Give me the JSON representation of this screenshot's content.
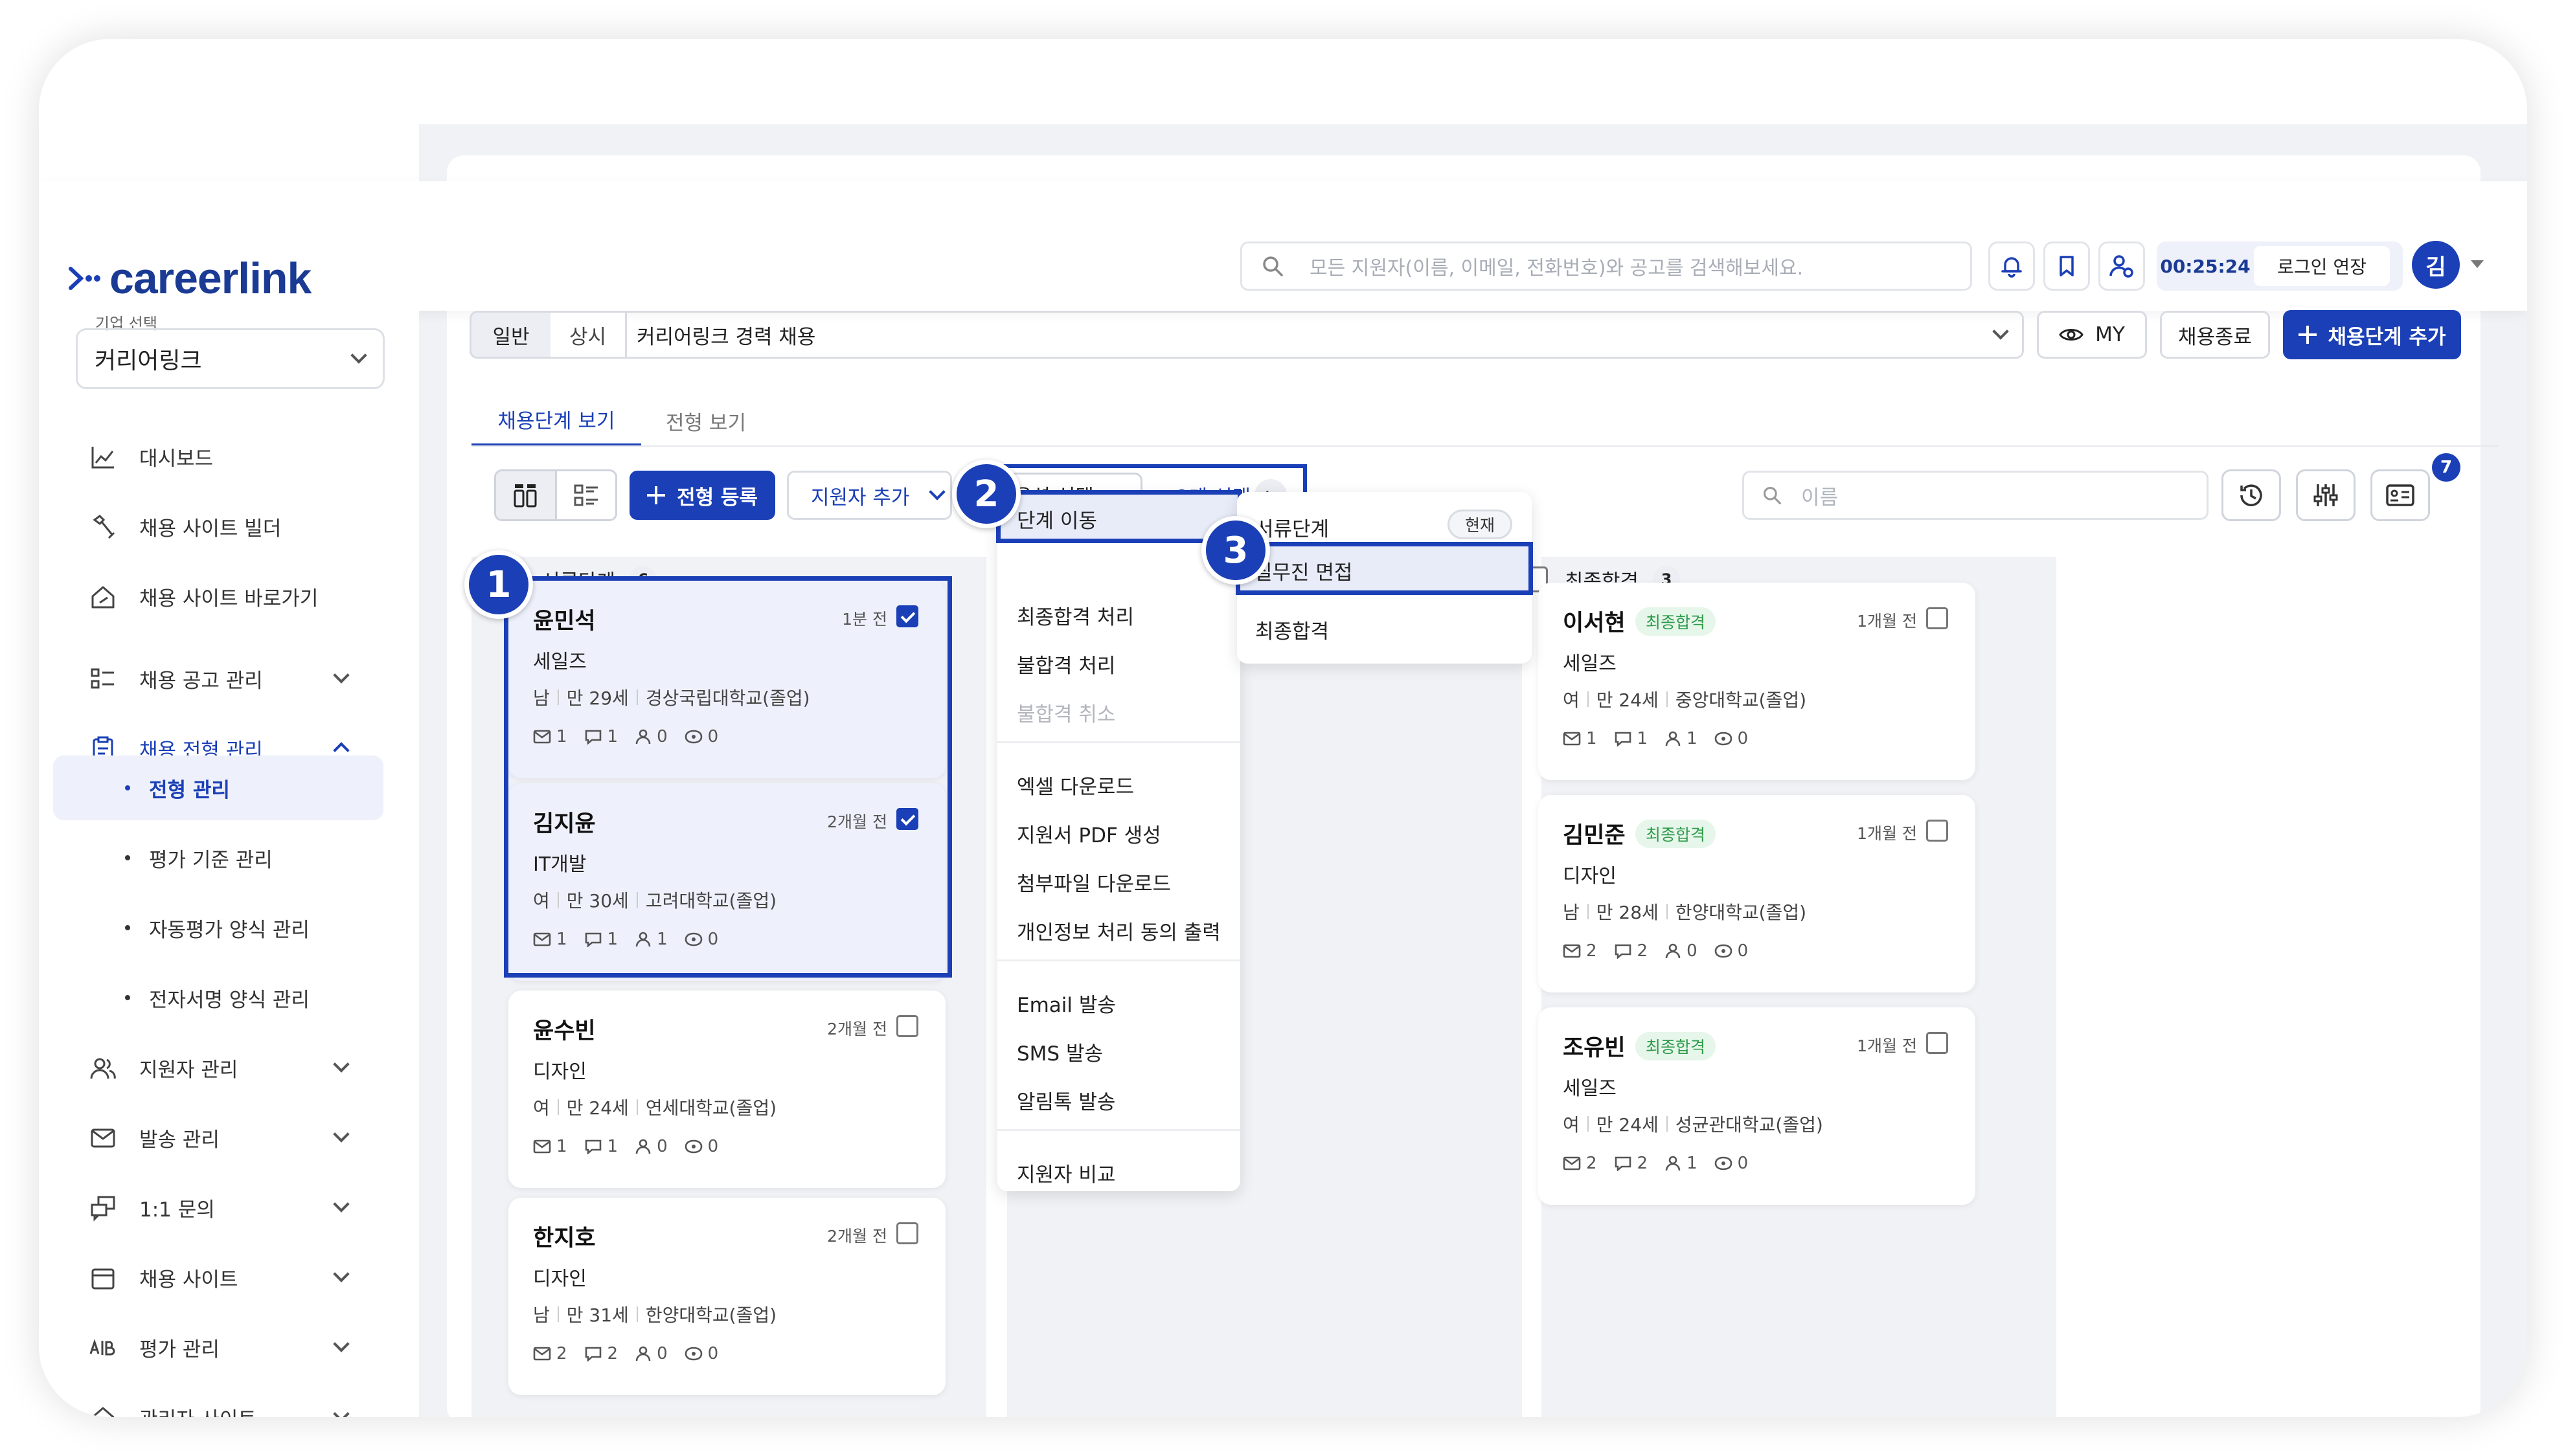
{
  "brand": {
    "logo_text": "careerlink",
    "accent": "#1a3fb6",
    "logo_color": "#1a3a94"
  },
  "header": {
    "search_placeholder": "모든 지원자(이름, 이메일, 전화번호)와 공고를 검색해보세요.",
    "icons": [
      "bell-icon",
      "bookmark-icon",
      "user-settings-icon"
    ],
    "timer": "00:25:24",
    "extend_login": "로그인 연장",
    "avatar_initial": "김"
  },
  "sidebar": {
    "company_label": "기업 선택",
    "company_value": "커리어링크",
    "items": [
      {
        "label": "대시보드",
        "icon": "chart-icon"
      },
      {
        "label": "채용 사이트 빌더",
        "icon": "tools-icon"
      },
      {
        "label": "채용 사이트 바로가기",
        "icon": "home-link-icon"
      },
      {
        "label": "채용 공고 관리",
        "icon": "list-icon"
      },
      {
        "label": "채용 전형 관리",
        "icon": "clipboard-icon"
      },
      {
        "label": "지원자 관리",
        "icon": "users-icon"
      },
      {
        "label": "발송 관리",
        "icon": "mail-icon"
      },
      {
        "label": "1:1 문의",
        "icon": "chat-icon"
      },
      {
        "label": "채용 사이트",
        "icon": "calendar-icon"
      },
      {
        "label": "평가 관리",
        "icon": "ab-icon"
      },
      {
        "label": "관리자 사이트",
        "icon": "admin-home-icon"
      }
    ],
    "sub_items": [
      "전형 관리",
      "평가 기준 관리",
      "자동평가 양식 관리",
      "전자서명 양식 관리"
    ]
  },
  "toolbar": {
    "type_tabs": [
      "일반",
      "상시"
    ],
    "job_title": "커리어링크 경력 채용",
    "my_label": "MY",
    "close_label": "채용종료",
    "add_stage_label": "채용단계 추가"
  },
  "tabs": [
    "채용단계 보기",
    "전형 보기"
  ],
  "actions": {
    "register_label": "전형 등록",
    "add_applicant_label": "지원자 추가",
    "option_select_label": "옵션 선택",
    "selected_count": "2개 선택",
    "name_search_placeholder": "이름",
    "notification_count": "7"
  },
  "columns": [
    {
      "title": "서류단계",
      "count": "6",
      "cards": [
        {
          "name": "윤민석",
          "time": "1분 전",
          "checked": true,
          "role": "세일즈",
          "gender": "남",
          "age": "만 29세",
          "school": "경상국립대학교(졸업)",
          "stats": [
            "1",
            "1",
            "0",
            "0"
          ]
        },
        {
          "name": "김지윤",
          "time": "2개월 전",
          "checked": true,
          "role": "IT개발",
          "gender": "여",
          "age": "만 30세",
          "school": "고려대학교(졸업)",
          "stats": [
            "1",
            "1",
            "1",
            "0"
          ]
        },
        {
          "name": "윤수빈",
          "time": "2개월 전",
          "checked": false,
          "role": "디자인",
          "gender": "여",
          "age": "만 24세",
          "school": "연세대학교(졸업)",
          "stats": [
            "1",
            "1",
            "0",
            "0"
          ]
        },
        {
          "name": "한지호",
          "time": "2개월 전",
          "checked": false,
          "role": "디자인",
          "gender": "남",
          "age": "만 31세",
          "school": "한양대학교(졸업)",
          "stats": [
            "2",
            "2",
            "0",
            "0"
          ]
        }
      ]
    },
    {
      "title": "최종합격",
      "count": "3",
      "cards": [
        {
          "name": "이서현",
          "tag": "최종합격",
          "time": "1개월 전",
          "checked": false,
          "role": "세일즈",
          "gender": "여",
          "age": "만 24세",
          "school": "중앙대학교(졸업)",
          "stats": [
            "1",
            "1",
            "1",
            "0"
          ]
        },
        {
          "name": "김민준",
          "tag": "최종합격",
          "time": "1개월 전",
          "checked": false,
          "role": "디자인",
          "gender": "남",
          "age": "만 28세",
          "school": "한양대학교(졸업)",
          "stats": [
            "2",
            "2",
            "0",
            "0"
          ]
        },
        {
          "name": "조유빈",
          "tag": "최종합격",
          "time": "1개월 전",
          "checked": false,
          "role": "세일즈",
          "gender": "여",
          "age": "만 24세",
          "school": "성균관대학교(졸업)",
          "stats": [
            "2",
            "2",
            "1",
            "0"
          ]
        }
      ]
    }
  ],
  "option_menu": {
    "items": [
      "단계 이동",
      "최종합격 처리",
      "불합격 처리",
      "불합격 취소",
      "엑셀 다운로드",
      "지원서 PDF 생성",
      "첨부파일 다운로드",
      "개인정보 처리 동의 출력",
      "Email 발송",
      "SMS 발송",
      "알림톡 발송",
      "지원자 비교"
    ]
  },
  "stage_menu": {
    "items": [
      "서류단계",
      "실무진 면접",
      "최종합격"
    ],
    "current_tag": "현재"
  },
  "steps": [
    "1",
    "2",
    "3"
  ]
}
